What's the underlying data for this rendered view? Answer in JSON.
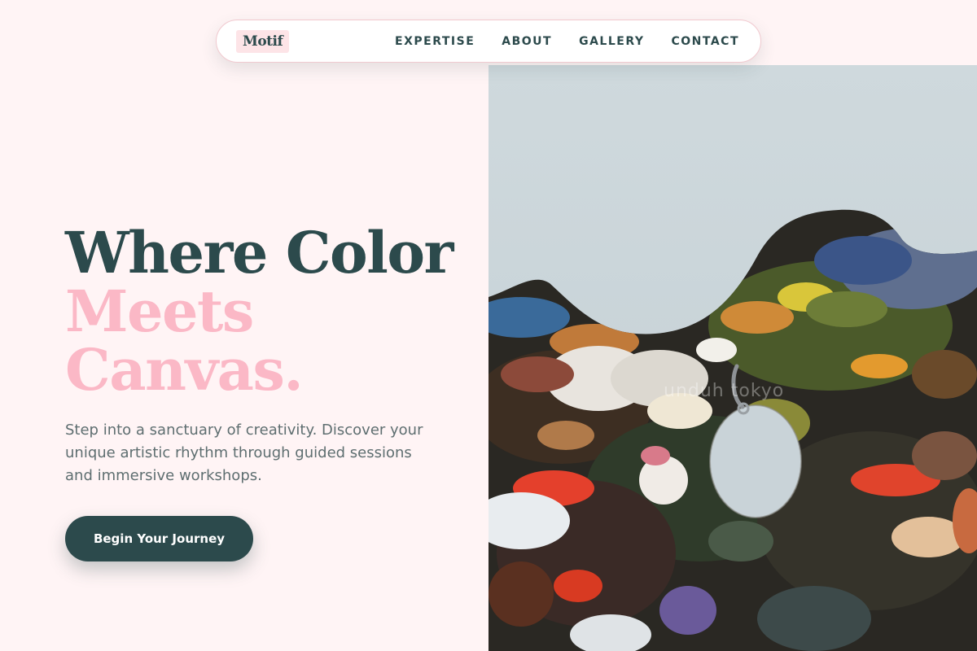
{
  "nav": {
    "logo": "Motif",
    "links": [
      "EXPERTISE",
      "ABOUT",
      "GALLERY",
      "CONTACT"
    ]
  },
  "hero": {
    "headline_line1": "Where Color",
    "headline_line2": "Meets",
    "headline_line3": "Canvas.",
    "subtitle": "Step into a sanctuary of creativity. Discover your unique artistic rhythm through guided sessions and immersive workshops.",
    "cta_label": "Begin Your Journey",
    "image": {
      "icon": "paint-palette-photo",
      "watermark": "unduh tokyo"
    }
  },
  "colors": {
    "background": "#fff4f5",
    "primary": "#2c4a4c",
    "accent_pink": "#fbb8c6",
    "body_text": "#5e6e70"
  }
}
